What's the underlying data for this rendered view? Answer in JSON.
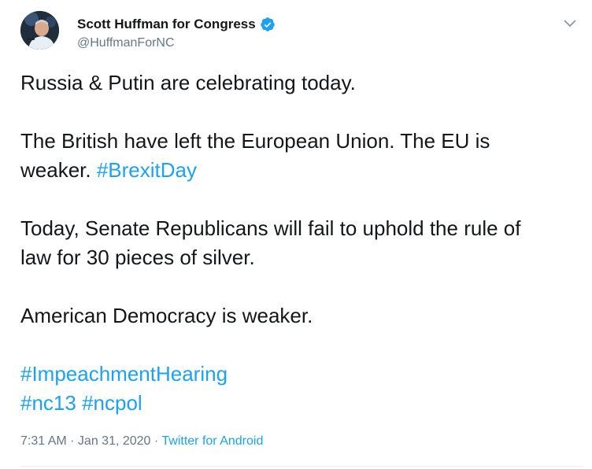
{
  "author": {
    "display_name": "Scott Huffman for Congress",
    "handle": "@HuffmanForNC",
    "verified_icon": "verified-badge-icon",
    "avatar_icon": "avatar"
  },
  "tweet": {
    "line1": "Russia & Putin are celebrating today.",
    "line2a": "The British have left the European Union. The EU is",
    "line2b": "weaker. ",
    "hashtag_brexit": "#BrexitDay",
    "line3a": "Today, Senate Republicans will fail to uphold the rule of",
    "line3b": "law for 30 pieces of silver.",
    "line4": "American Democracy is weaker.",
    "hashtag_impeachment": "#ImpeachmentHearing",
    "hashtag_nc13": "#nc13",
    "hashtag_ncpol": "#ncpol"
  },
  "meta": {
    "time": "7:31 AM",
    "sep1": " · ",
    "date": "Jan 31, 2020",
    "sep2": " · ",
    "source": "Twitter for Android"
  },
  "colors": {
    "link": "#1da1f2",
    "secondary_text": "#657786",
    "primary_text": "#14171a"
  }
}
